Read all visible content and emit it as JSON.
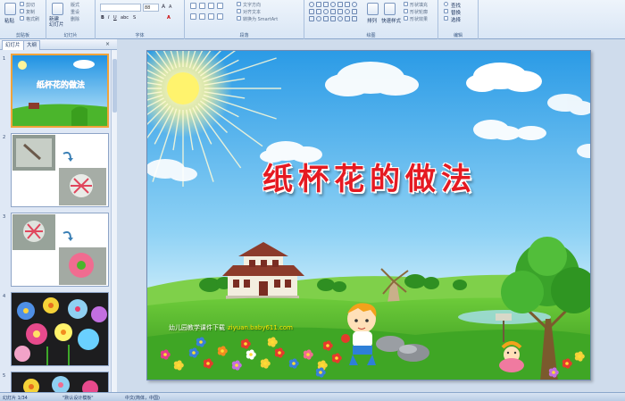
{
  "ribbon": {
    "clipboard": {
      "paste": "粘贴",
      "cut": "剪切",
      "copy": "复制",
      "format_painter": "格式刷",
      "group": "剪贴板"
    },
    "slides": {
      "new_slide": "新建\n幻灯片",
      "layout": "版式",
      "reset": "重设",
      "delete": "删除",
      "group": "幻灯片"
    },
    "font": {
      "group": "字体",
      "size": "88"
    },
    "paragraph": {
      "text_direction": "文字方向",
      "align_text": "对齐文本",
      "convert_smartart": "转换为 SmartArt",
      "group": "段落"
    },
    "drawing": {
      "arrange": "排列",
      "quick_styles": "快速样式",
      "shape_fill": "形状填充",
      "shape_outline": "形状轮廓",
      "shape_effects": "形状效果",
      "group": "绘图"
    },
    "editing": {
      "find": "查找",
      "replace": "替换",
      "select": "选择",
      "group": "编辑"
    }
  },
  "left_pane": {
    "tabs": [
      "幻灯片",
      "大纲"
    ],
    "thumbnails": [
      {
        "num": "1",
        "title": "纸杯花的做法"
      },
      {
        "num": "2"
      },
      {
        "num": "3"
      },
      {
        "num": "4"
      },
      {
        "num": "5"
      }
    ]
  },
  "slide": {
    "title": "纸杯花的做法",
    "watermark_text": "幼儿园教学课件下载",
    "watermark_url": "ziyuan.baby611.com"
  },
  "status_bar": {
    "slide_info": "幻灯片 1/34",
    "theme": "\"默认设计模板\"",
    "language": "中文(简体，中国)"
  },
  "colors": {
    "title_red": "#e51a22",
    "sky_top": "#2b9be6",
    "grass": "#4bb52c",
    "selected_border": "#f0a33a"
  }
}
